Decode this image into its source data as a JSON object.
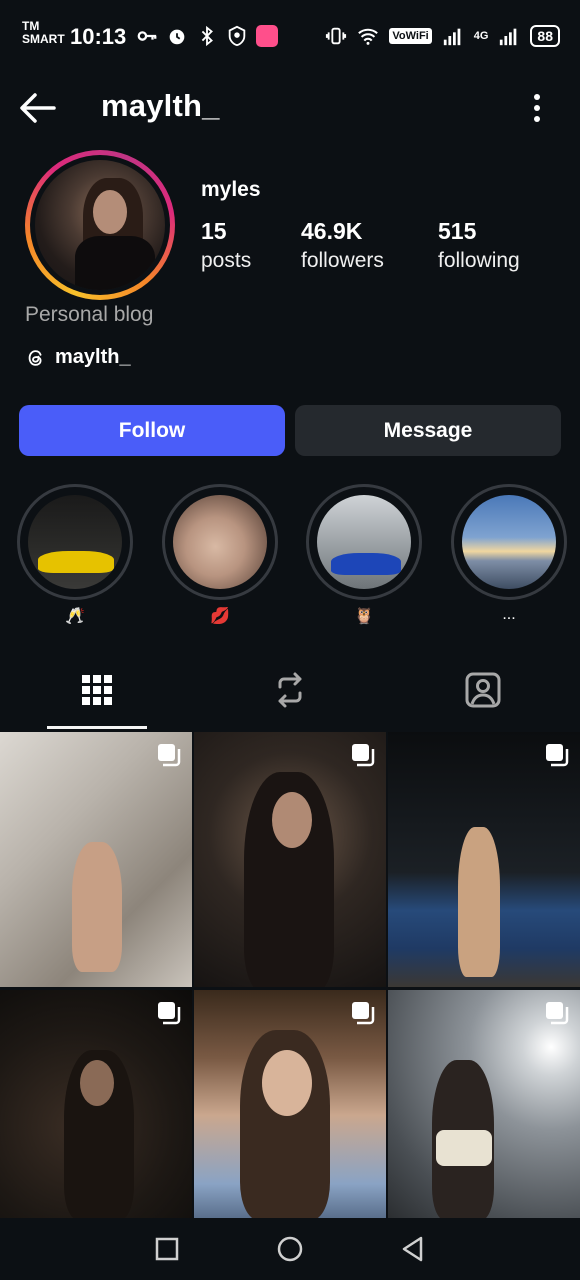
{
  "status_bar": {
    "carrier_line1": "TM",
    "carrier_line2": "SMART",
    "time": "10:13",
    "vowifi": "VoWiFi",
    "network": "4G",
    "battery": "88"
  },
  "header": {
    "username": "maylth_"
  },
  "profile": {
    "display_name": "myles",
    "stats": [
      {
        "value": "15",
        "label": "posts"
      },
      {
        "value": "46.9K",
        "label": "followers"
      },
      {
        "value": "515",
        "label": "following"
      }
    ],
    "category": "Personal blog",
    "threads_handle": "maylth_"
  },
  "actions": {
    "follow_label": "Follow",
    "message_label": "Message"
  },
  "highlights": [
    {
      "label": "🥂"
    },
    {
      "label": "💋"
    },
    {
      "label": "🦉"
    },
    {
      "label": "..."
    }
  ],
  "tabs": [
    {
      "icon": "grid-icon"
    },
    {
      "icon": "reels-repost-icon"
    },
    {
      "icon": "tagged-person-icon"
    }
  ],
  "colors": {
    "background": "#0c1014",
    "follow_button": "#4a5df9",
    "message_button": "#25292e",
    "secondary_text": "#a8a8a8"
  }
}
